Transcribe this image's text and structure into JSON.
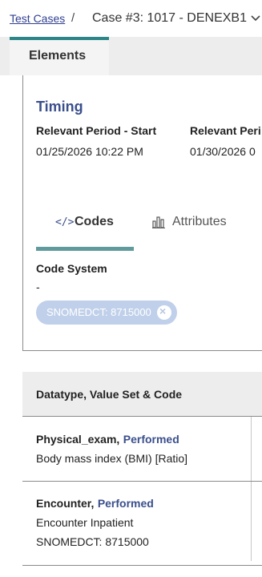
{
  "breadcrumb": {
    "link": "Test Cases",
    "separator": "/",
    "current": "Case #3: 1017 - DENEXB1",
    "chevron_icon": "chevron-down-icon"
  },
  "tabs": {
    "elements_label": "Elements"
  },
  "timing": {
    "title": "Timing",
    "start_label": "Relevant Period - Start",
    "start_value": "01/25/2026 10:22 PM",
    "end_label": "Relevant Peri",
    "end_value": "01/30/2026 0"
  },
  "detail_tabs": {
    "codes_icon_text": "</>",
    "codes_label": "Codes",
    "attributes_label": "Attributes",
    "attributes_icon": "bar-chart-icon"
  },
  "code_system": {
    "label": "Code System",
    "value": "-",
    "chip_label": "SNOMEDCT: 8715000",
    "chip_close_glyph": "×"
  },
  "table": {
    "header": "Datatype, Value Set & Code",
    "rows": [
      {
        "type": "Physical_exam,",
        "status": "Performed",
        "line1": "Body mass index (BMI) [Ratio]",
        "line2": ""
      },
      {
        "type": "Encounter,",
        "status": "Performed",
        "line1": "Encounter Inpatient",
        "line2": "SNOMEDCT: 8715000"
      }
    ]
  },
  "colors": {
    "accent_teal": "#2c8587",
    "title_blue": "#3a4f8c",
    "chip_bg": "#c0d0ea"
  }
}
